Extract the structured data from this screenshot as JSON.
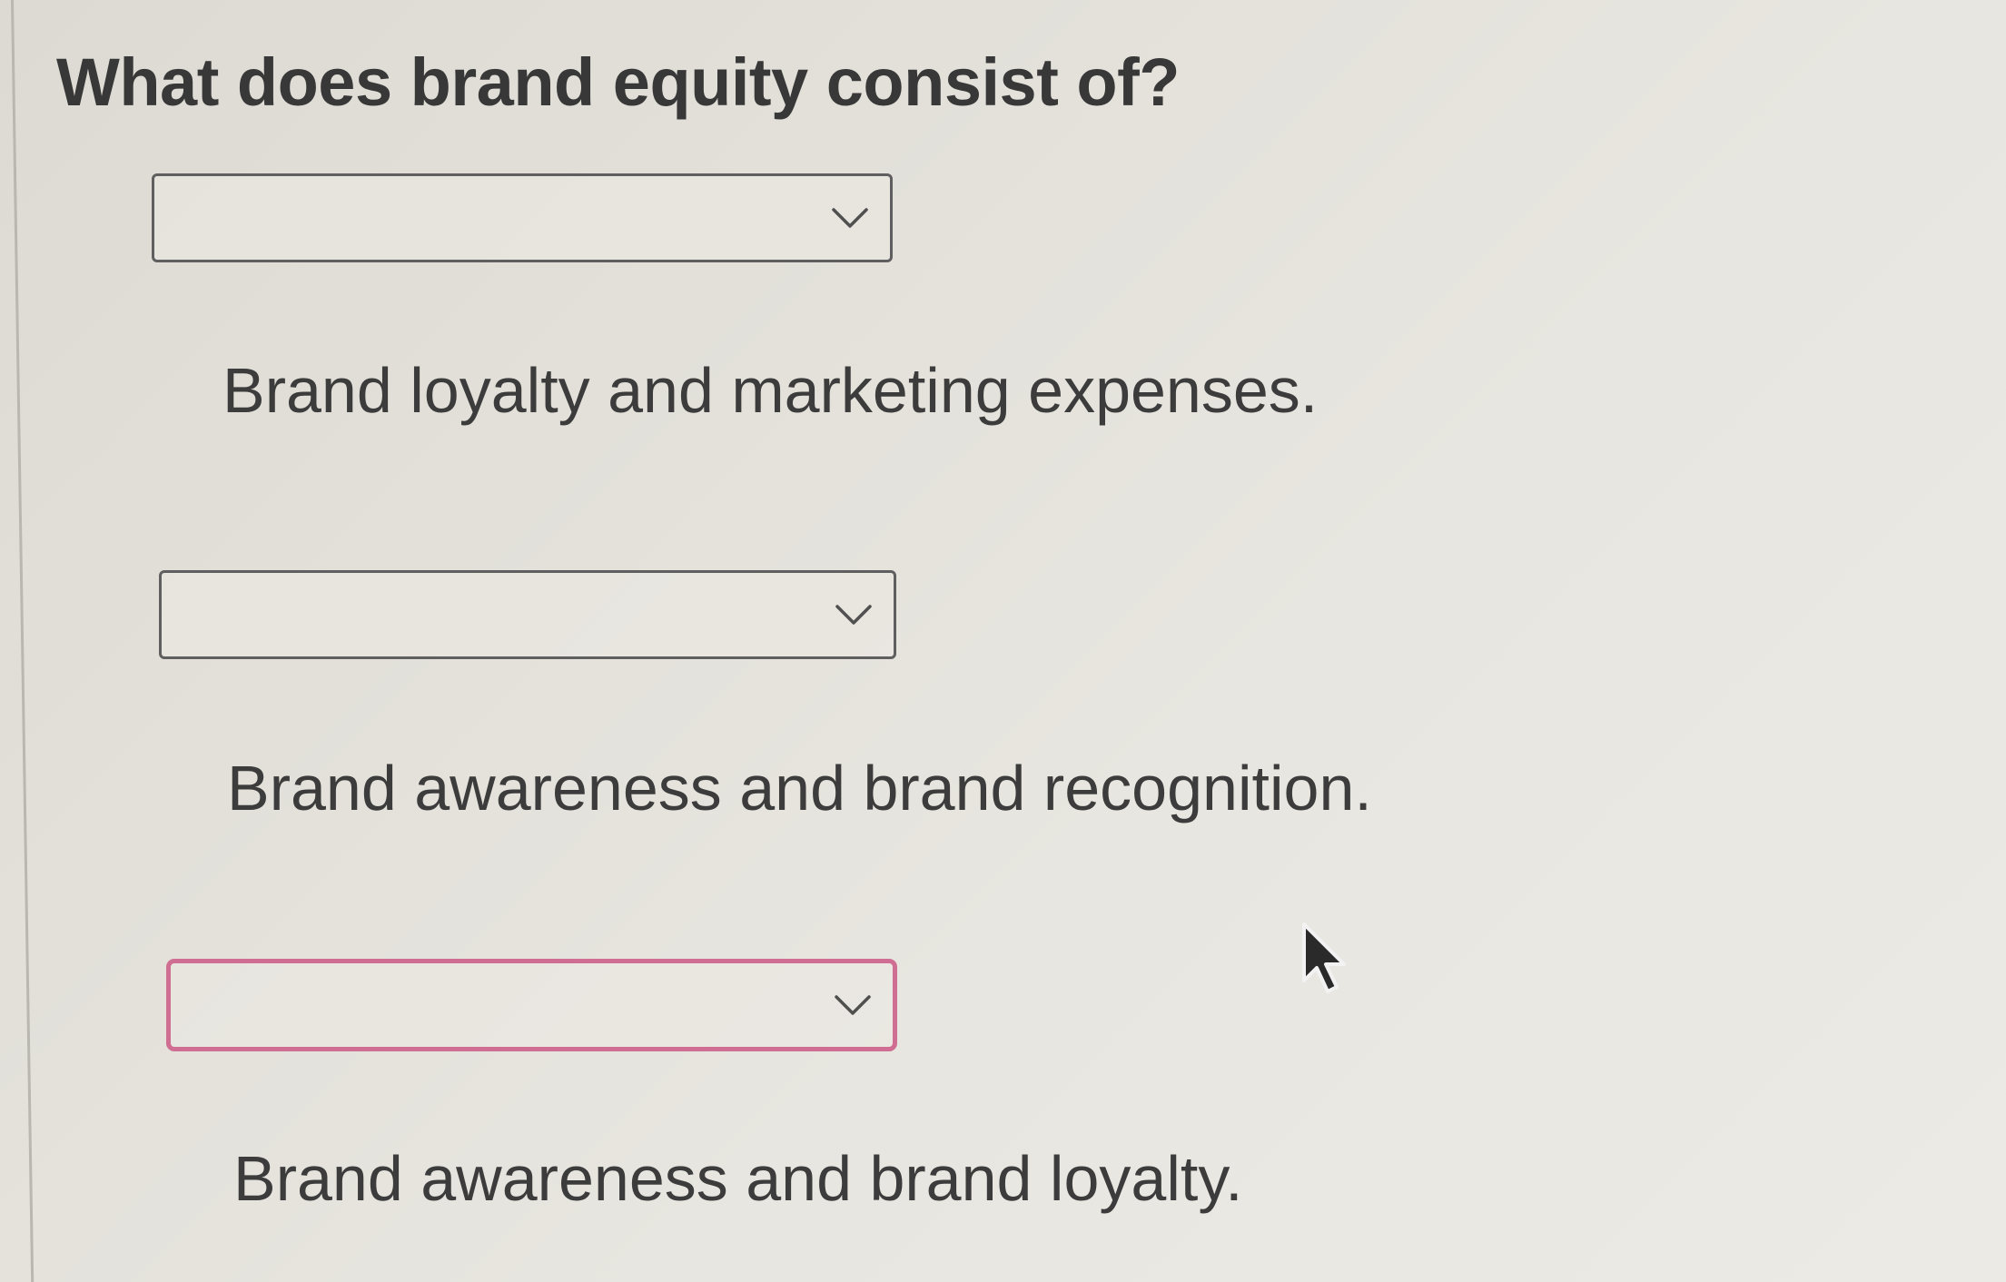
{
  "question": {
    "text": "What does brand equity consist of?"
  },
  "items": [
    {
      "select": {
        "selected_value": "",
        "state": "default"
      },
      "label": "Brand loyalty and marketing expenses."
    },
    {
      "select": {
        "selected_value": "",
        "state": "default"
      },
      "label": "Brand awareness and brand recognition."
    },
    {
      "select": {
        "selected_value": "",
        "state": "invalid"
      },
      "label": "Brand awareness and brand loyalty."
    }
  ],
  "icons": {
    "dropdown": "chevron-down-icon",
    "pointer": "mouse-pointer-icon"
  },
  "colors": {
    "select_border": "#5f5f5f",
    "invalid_border": "#cf6d92",
    "text": "#3c3c3c",
    "background": "#e4e2dc"
  }
}
